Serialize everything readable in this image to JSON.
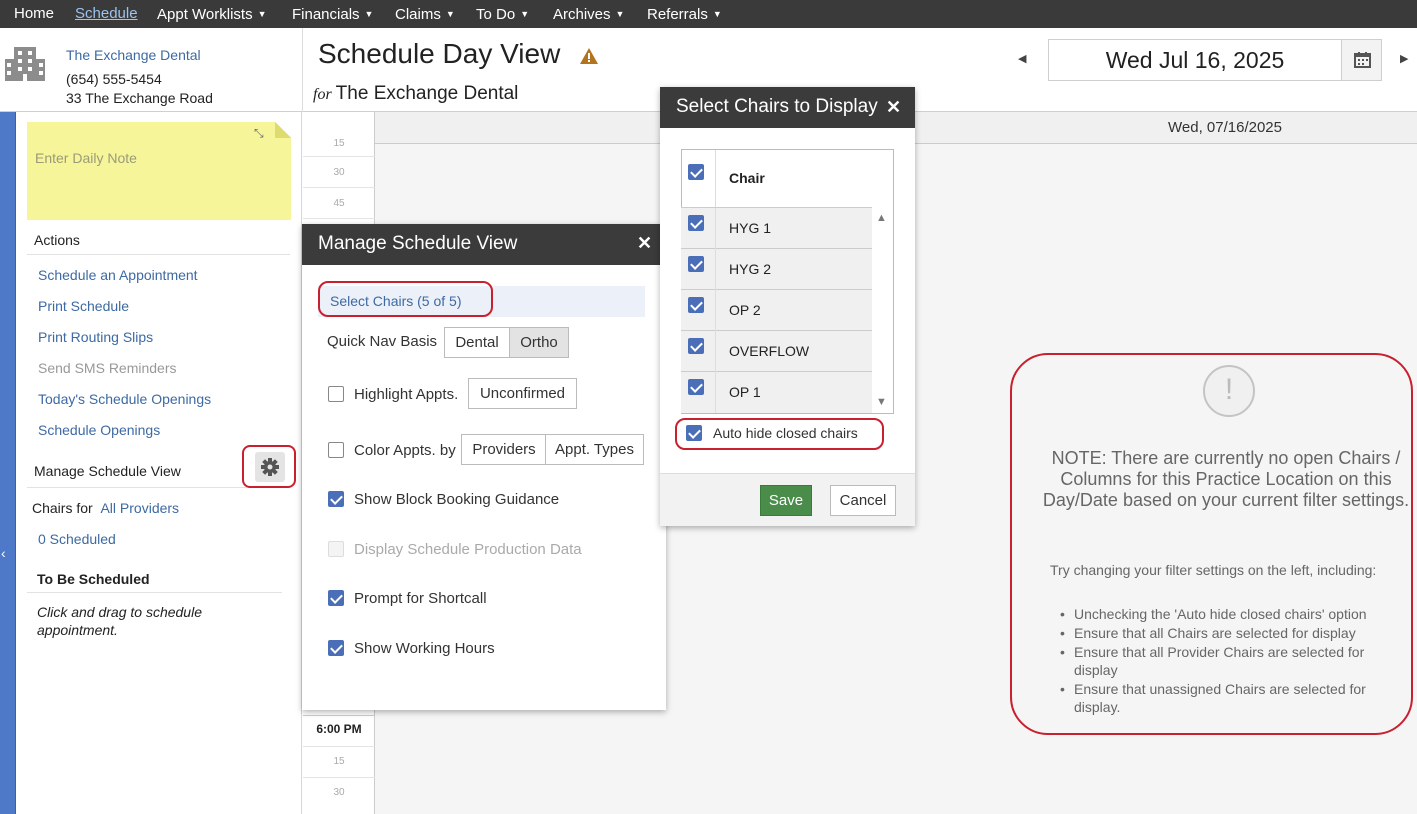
{
  "nav": {
    "items": [
      {
        "label": "Home",
        "dropdown": false,
        "active": false
      },
      {
        "label": "Schedule",
        "dropdown": false,
        "active": true
      },
      {
        "label": "Appt Worklists",
        "dropdown": true,
        "active": false
      },
      {
        "label": "Financials",
        "dropdown": true,
        "active": false
      },
      {
        "label": "Claims",
        "dropdown": true,
        "active": false
      },
      {
        "label": "To Do",
        "dropdown": true,
        "active": false
      },
      {
        "label": "Archives",
        "dropdown": true,
        "active": false
      },
      {
        "label": "Referrals",
        "dropdown": true,
        "active": false
      }
    ]
  },
  "practice": {
    "name": "The Exchange Dental",
    "phone": "(654) 555-5454",
    "address": "33 The Exchange Road"
  },
  "header": {
    "title": "Schedule Day View",
    "for_label": "for",
    "for_value": "The Exchange Dental",
    "date": "Wed Jul 16, 2025"
  },
  "sidebar": {
    "note_placeholder": "Enter Daily Note",
    "actions_title": "Actions",
    "actions": [
      {
        "label": "Schedule an Appointment",
        "enabled": true
      },
      {
        "label": "Print Schedule",
        "enabled": true
      },
      {
        "label": "Print Routing Slips",
        "enabled": true
      },
      {
        "label": "Send SMS Reminders",
        "enabled": false
      },
      {
        "label": "Today's Schedule Openings",
        "enabled": true
      },
      {
        "label": "Schedule Openings",
        "enabled": true
      }
    ],
    "manage_title": "Manage Schedule View",
    "chairs_for_label": "Chairs for",
    "chairs_for_value": "All Providers",
    "scheduled_count": "0 Scheduled",
    "to_be_scheduled_title": "To Be Scheduled",
    "to_be_scheduled_hint": "Click and drag to schedule appointment."
  },
  "grid": {
    "column_header": "Wed, 07/16/2025",
    "ticks_top": [
      "15",
      "30",
      "45"
    ],
    "time_label": "6:00 PM",
    "ticks_bottom": [
      "15",
      "30"
    ]
  },
  "notice": {
    "message": "NOTE: There are currently no open Chairs / Columns for this Practice Location on this Day/Date based on your current filter settings.",
    "sub": "Try changing your filter settings on the left, including:",
    "bullets": [
      "Unchecking the 'Auto hide closed chairs' option",
      "Ensure that all Chairs are selected for display",
      "Ensure that all Provider Chairs are selected for display",
      "Ensure that unassigned Chairs are selected for display."
    ]
  },
  "manage_dialog": {
    "title": "Manage Schedule View",
    "select_chairs": "Select Chairs (5 of 5)",
    "quick_nav_label": "Quick Nav Basis",
    "quick_nav_options": [
      "Dental",
      "Ortho"
    ],
    "quick_nav_selected": "Ortho",
    "highlight_label": "Highlight Appts.",
    "highlight_button": "Unconfirmed",
    "color_label": "Color Appts. by",
    "color_options": [
      "Providers",
      "Appt. Types"
    ],
    "options": {
      "block_booking": {
        "label": "Show Block Booking Guidance",
        "checked": true
      },
      "production": {
        "label": "Display Schedule Production Data",
        "checked": false,
        "disabled": true
      },
      "shortcall": {
        "label": "Prompt for Shortcall",
        "checked": true
      },
      "working_hours": {
        "label": "Show Working Hours",
        "checked": true
      }
    }
  },
  "chairs_dialog": {
    "title": "Select Chairs to Display",
    "header": "Chair",
    "chairs": [
      {
        "name": "HYG 1",
        "checked": true
      },
      {
        "name": "HYG 2",
        "checked": true
      },
      {
        "name": "OP 2",
        "checked": true
      },
      {
        "name": "OVERFLOW",
        "checked": true
      },
      {
        "name": "OP 1",
        "checked": true
      }
    ],
    "auto_hide_label": "Auto hide closed chairs",
    "save_label": "Save",
    "cancel_label": "Cancel"
  },
  "colors": {
    "nav_bg": "#3a3a3a",
    "link": "#3d6aa3",
    "checkbox": "#4a6fb8",
    "save": "#4a8c4a",
    "highlight": "#c8202f"
  }
}
